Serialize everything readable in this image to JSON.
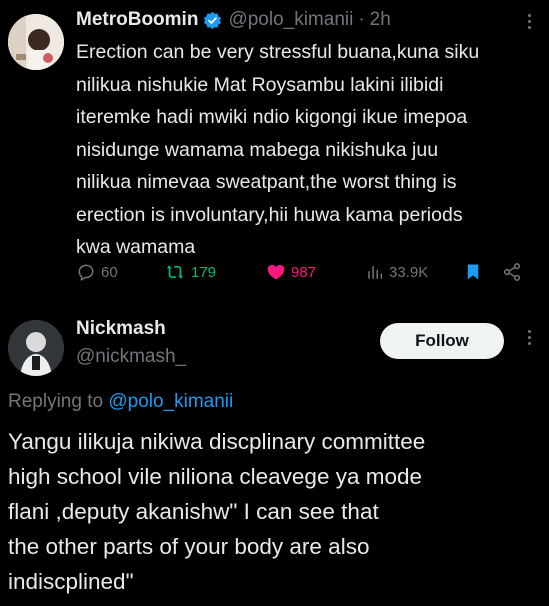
{
  "tweet": {
    "author_name": "MetroBoomin",
    "handle": "@polo_kimanii",
    "separator": "·",
    "time": "2h",
    "text": "Erection can be very stressful buana,kuna siku\nnilikua nishukie Mat Roysambu lakini ilibidi\niteremke hadi mwiki ndio kigongi ikue imepoa\nnisidunge wamama mabega nikishuka juu\nnilikua nimevaa sweatpant,the worst thing is\nerection is involuntary,hii huwa kama periods\nkwa wamama",
    "actions": {
      "replies": "60",
      "reposts": "179",
      "likes": "987",
      "views": "33.9K"
    },
    "icons": [
      "verified-badge-icon",
      "reply-icon",
      "repost-icon",
      "heart-icon",
      "views-icon",
      "bookmark-icon",
      "share-icon",
      "more-icon"
    ],
    "colors": {
      "repost": "#00ba7c",
      "like": "#f91880",
      "bookmark": "#1d9bf0",
      "verified": "#1d9bf0"
    }
  },
  "reply": {
    "author_name": "Nickmash",
    "handle": "@nickmash_",
    "follow_label": "Follow",
    "replying_prefix": "Replying to",
    "replying_to": "@polo_kimanii",
    "text": "Yangu ilikuja nikiwa discplinary committee\nhigh school vile niliona cleavege ya mode\nflani ,deputy akanishw\" I can see that\nthe other parts of your body are also\nindiscplined\""
  }
}
